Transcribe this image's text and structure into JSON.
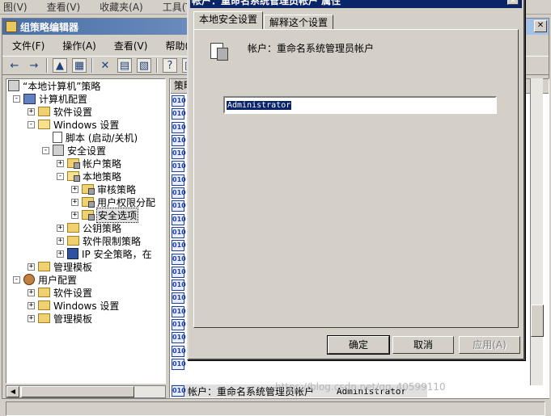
{
  "ie_menu": [
    "图(V)",
    "查看(V)",
    "收藏夹(A)",
    "工具(T)"
  ],
  "gp": {
    "title": "组策略编辑器",
    "menus": [
      "文件(F)",
      "操作(A)",
      "查看(V)",
      "帮助(H)"
    ]
  },
  "tree": {
    "root": "“本地计算机”策略",
    "computer_config": "计算机配置",
    "software_settings": "软件设置",
    "windows_settings": "Windows 设置",
    "scripts": "脚本 (启动/关机)",
    "security_settings": "安全设置",
    "account_policies": "帐户策略",
    "local_policies": "本地策略",
    "audit_policy": "审核策略",
    "user_rights": "用户权限分配",
    "security_options": "安全选项",
    "public_key": "公钥策略",
    "software_restriction": "软件限制策略",
    "ip_security": "IP 安全策略，在",
    "admin_templates": "管理模板",
    "user_config": "用户配置",
    "user_software_settings": "软件设置",
    "user_windows_settings": "Windows 设置",
    "user_admin_templates": "管理模板"
  },
  "list": {
    "header": "策略",
    "selected_row_name": "帐户：重命名系统管理员帐户",
    "selected_row_value": "Administrator"
  },
  "dialog": {
    "title": "帐户：重命名系统管理员帐户 属性",
    "tab_local": "本地安全设置",
    "tab_explain": "解释这个设置",
    "policy_name": "帐户：重命名系统管理员帐户",
    "value": "Administrator",
    "ok": "确定",
    "cancel": "取消",
    "apply": "应用(A)"
  },
  "watermark": "https://blog.csdn.net/qq_40599110"
}
